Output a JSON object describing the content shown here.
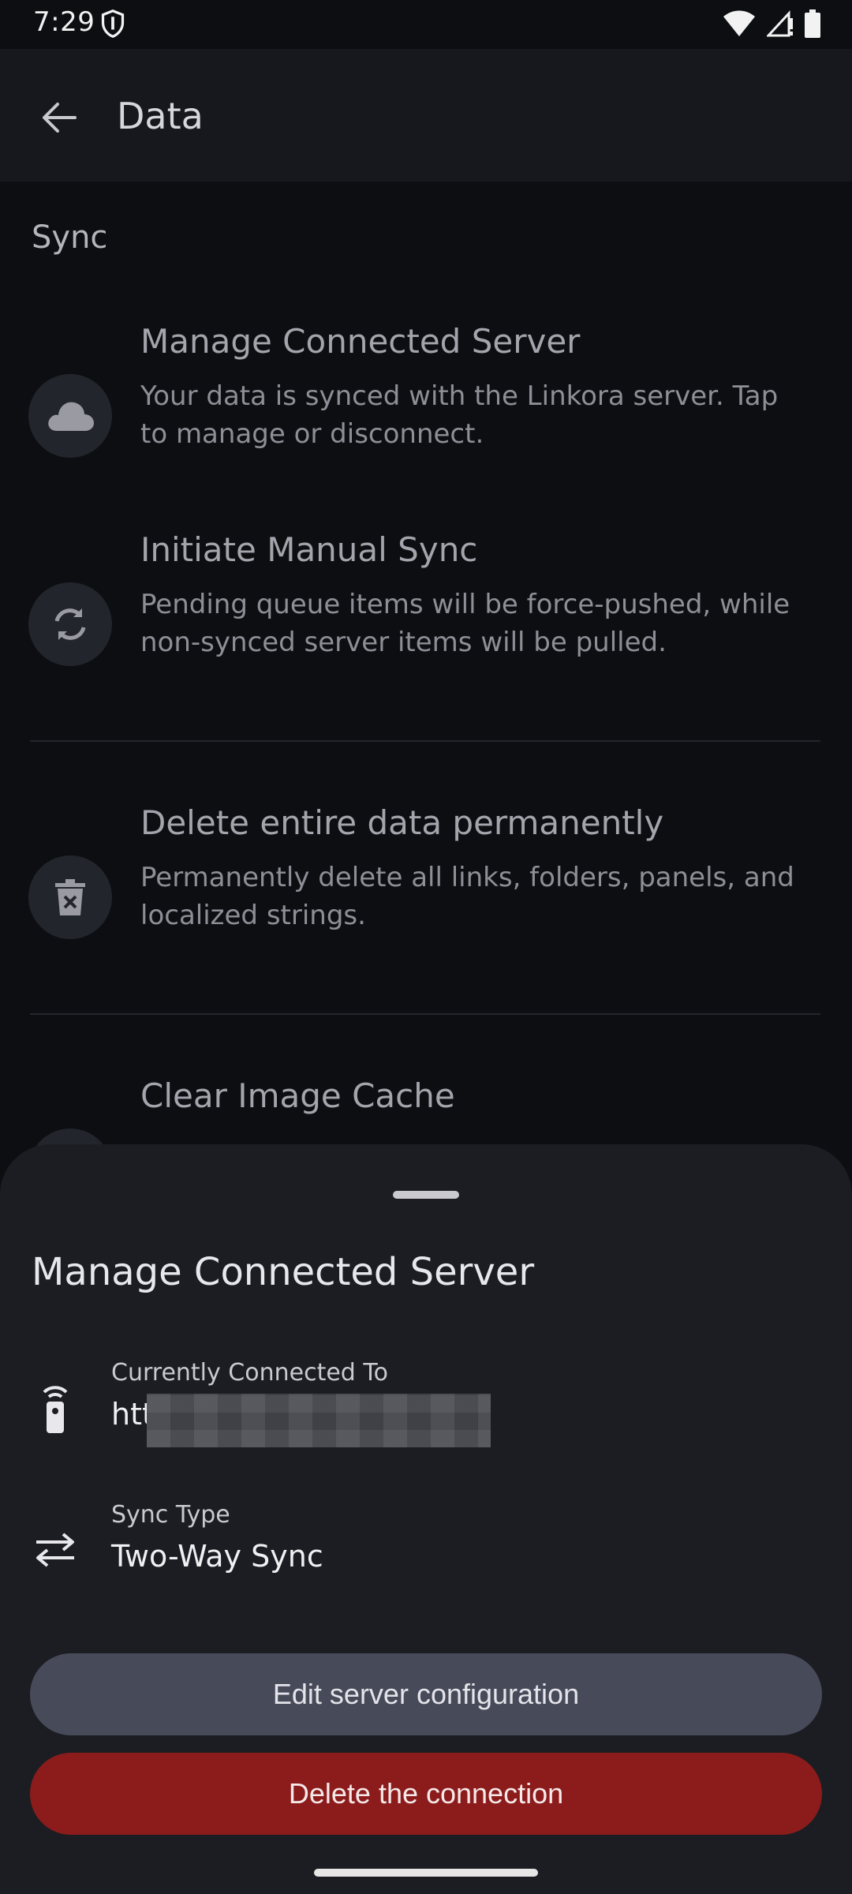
{
  "status_bar": {
    "time": "7:29",
    "icons": [
      "shield-icon",
      "wifi-icon",
      "signal-icon",
      "battery-icon"
    ]
  },
  "app_bar": {
    "title": "Data",
    "back_icon": "arrow-left-icon"
  },
  "content": {
    "section_title": "Sync",
    "settings": [
      {
        "icon": "cloud-icon",
        "title": "Manage Connected Server",
        "description": "Your data is synced with the Linkora server. Tap to manage or disconnect."
      },
      {
        "icon": "sync-icon",
        "title": "Initiate Manual Sync",
        "description": "Pending queue items will be force-pushed, while non-synced server items will be pulled."
      },
      {
        "icon": "delete-forever-icon",
        "title": "Delete entire data permanently",
        "description": "Permanently delete all links, folders, panels, and localized strings."
      },
      {
        "icon": "image-icon",
        "title": "Clear Image Cache",
        "description": ""
      }
    ]
  },
  "sheet": {
    "title": "Manage Connected Server",
    "connected": {
      "label": "Currently Connected To",
      "value": "htt",
      "icon": "router-icon"
    },
    "sync_type": {
      "label": "Sync Type",
      "value": "Two-Way Sync",
      "icon": "swap-horiz-icon"
    },
    "edit_button": "Edit server configuration",
    "delete_button": "Delete the connection"
  },
  "colors": {
    "background": "#0d0e12",
    "sheet": "#1c1d22",
    "edit_button": "#474a59",
    "delete_button": "#8c1c1c"
  }
}
